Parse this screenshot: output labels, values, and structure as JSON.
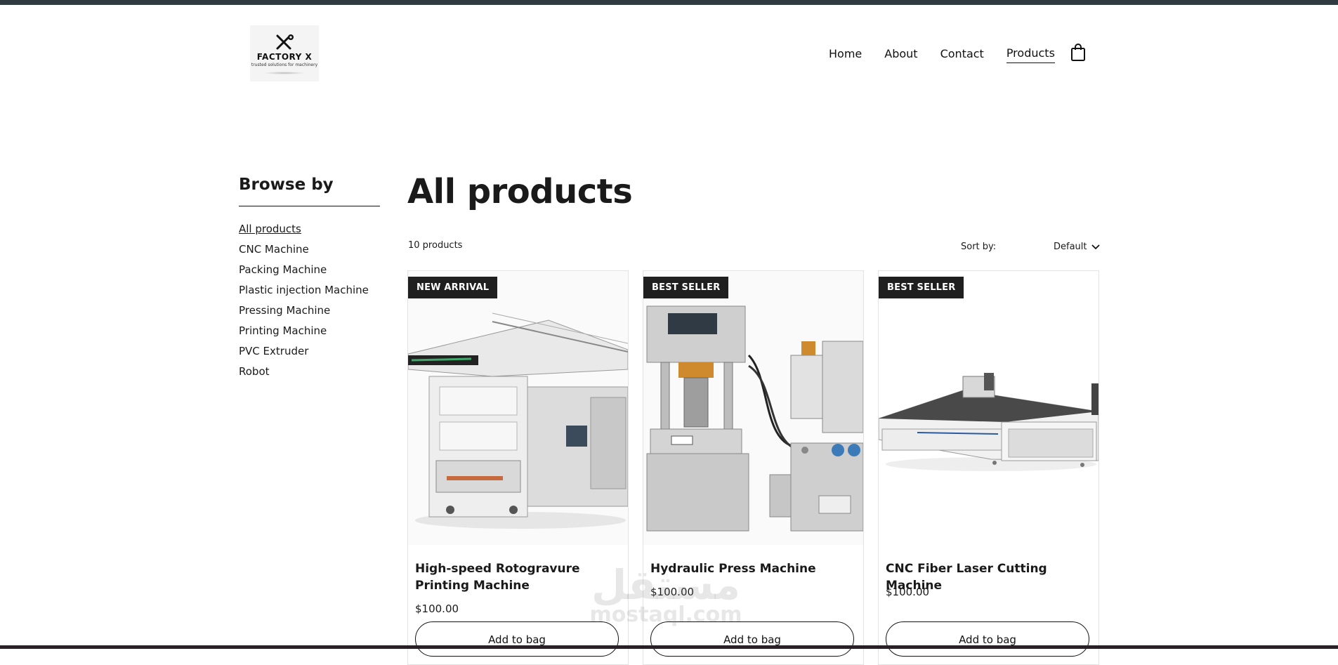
{
  "header": {
    "logo": {
      "name": "FACTORY X",
      "tagline": "trusted solutions for machinery"
    },
    "nav": [
      {
        "label": "Home",
        "active": false
      },
      {
        "label": "About",
        "active": false
      },
      {
        "label": "Contact",
        "active": false
      },
      {
        "label": "Products",
        "active": true
      }
    ],
    "bag_icon": "shopping-bag-icon"
  },
  "sidebar": {
    "title": "Browse by",
    "categories": [
      {
        "label": "All products",
        "active": true
      },
      {
        "label": "CNC Machine"
      },
      {
        "label": "Packing Machine"
      },
      {
        "label": "Plastic injection Machine"
      },
      {
        "label": "Pressing Machine"
      },
      {
        "label": "Printing Machine"
      },
      {
        "label": "PVC Extruder"
      },
      {
        "label": "Robot"
      }
    ]
  },
  "main": {
    "title": "All products",
    "count": "10 products",
    "sort": {
      "label": "Sort by:",
      "value": "Default"
    },
    "products": [
      {
        "badge": "NEW ARRIVAL",
        "name": "High-speed Rotogravure Printing Machine",
        "price": "$100.00",
        "button": "Add to bag"
      },
      {
        "badge": "BEST SELLER",
        "name": "Hydraulic Press Machine",
        "price": "$100.00",
        "button": "Add to bag"
      },
      {
        "badge": "BEST SELLER",
        "name": "CNC Fiber Laser Cutting Machine",
        "price": "$100.00",
        "button": "Add to bag"
      }
    ]
  },
  "watermark": {
    "arabic": "مستقل",
    "latin": "mostaql.com"
  },
  "colors": {
    "top_bar": "#2f3b40",
    "badge_bg": "#1f1f1f",
    "text": "#1a1a1a"
  }
}
